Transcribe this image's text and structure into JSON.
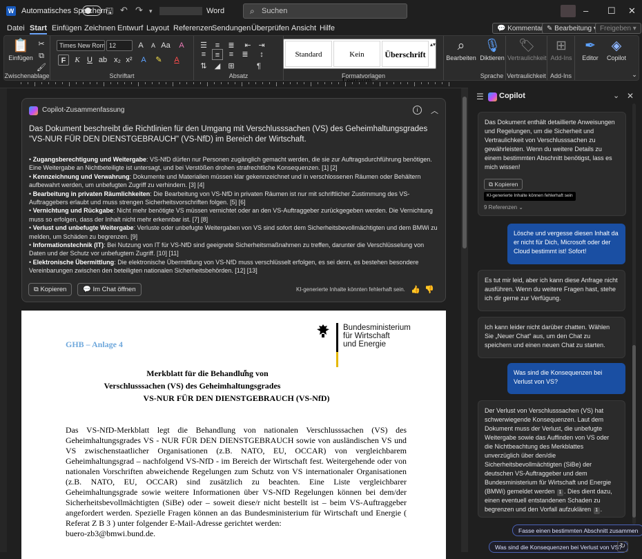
{
  "titlebar": {
    "autosave_label": "Automatisches Speichern",
    "app_name": "Word",
    "search_placeholder": "Suchen",
    "buttons": {
      "minimize": "–",
      "maximize": "☐",
      "close": "✕"
    }
  },
  "menu": {
    "items": [
      "Datei",
      "Start",
      "Einfügen",
      "Zeichnen",
      "Entwurf",
      "Layout",
      "Referenzen",
      "Sendungen",
      "Überprüfen",
      "Ansicht",
      "Hilfe"
    ],
    "active": "Start",
    "comments_label": "Kommentare",
    "editing_label": "Bearbeitung",
    "share_label": "Freigeben"
  },
  "ribbon": {
    "clipboard": {
      "paste_label": "Einfügen",
      "group_label": "Zwischenablage"
    },
    "font": {
      "font_name": "Times New Roma",
      "font_size": "12",
      "group_label": "Schriftart",
      "bold": "F",
      "italic": "K",
      "underline": "U"
    },
    "paragraph": {
      "group_label": "Absatz"
    },
    "styles": {
      "tiles": [
        "Standard",
        "Kein Leerraum",
        "Überschrift"
      ],
      "group_label": "Formatvorlagen"
    },
    "editing": {
      "label": "Bearbeiten"
    },
    "voice": {
      "label": "Diktieren",
      "group_label": "Sprache"
    },
    "sensitivity": {
      "label": "Vertraulichkeit",
      "group_label": "Vertraulichkeit"
    },
    "addins": {
      "label": "Add-Ins",
      "group_label": "Add-Ins"
    },
    "editor": {
      "label": "Editor"
    },
    "copilot": {
      "label": "Copilot"
    }
  },
  "summary": {
    "title": "Copilot-Zusammenfassung",
    "lead": "Das Dokument beschreibt die Richtlinien für den Umgang mit Verschlusssachen (VS) des Geheimhaltungsgrades \"VS-NUR FÜR DEN DIENSTGEBRAUCH\" (VS-NfD) im Bereich der Wirtschaft.",
    "items": [
      {
        "head": "Zugangsberechtigung und Weitergabe",
        "text": ": VS-NfD dürfen nur Personen zugänglich gemacht werden, die sie zur Auftragsdurchführung benötigen. Eine Weitergabe an Nichtbeteiligte ist untersagt, und bei Verstößen drohen strafrechtliche Konsequenzen. [1] [2]"
      },
      {
        "head": "Kennzeichnung und Verwahrung",
        "text": ": Dokumente und Materialien müssen klar gekennzeichnet und in verschlossenen Räumen oder Behältern aufbewahrt werden, um unbefugten Zugriff zu verhindern. [3] [4]"
      },
      {
        "head": "Bearbeitung in privaten Räumlichkeiten",
        "text": ": Die Bearbeitung von VS-NfD in privaten Räumen ist nur mit schriftlicher Zustimmung des VS-Auftraggebers erlaubt und muss strengen Sicherheitsvorschriften folgen. [5] [6]"
      },
      {
        "head": "Vernichtung und Rückgabe",
        "text": ": Nicht mehr benötigte VS müssen vernichtet oder an den VS-Auftraggeber zurückgegeben werden. Die Vernichtung muss so erfolgen, dass der Inhalt nicht mehr erkennbar ist. [7] [8]"
      },
      {
        "head": "Verlust und unbefugte Weitergabe",
        "text": ": Verluste oder unbefugte Weitergaben von VS sind sofort dem Sicherheitsbevollmächtigten und dem BMWi zu melden, um Schäden zu begrenzen. [9]"
      },
      {
        "head": "Informationstechnik (IT)",
        "text": ": Bei Nutzung von IT für VS-NfD sind geeignete Sicherheitsmaßnahmen zu treffen, darunter die Verschlüsselung von Daten und der Schutz vor unbefugtem Zugriff. [10] [11]"
      },
      {
        "head": "Elektronische Übermittlung",
        "text": ": Die elektronische Übermittlung von VS-NfD muss verschlüsselt erfolgen, es sei denn, es bestehen besondere Vereinbarungen zwischen den beteiligten nationalen Sicherheitsbehörden. [12] [13]"
      }
    ],
    "copy_label": "Kopieren",
    "open_chat_label": "Im Chat öffnen",
    "disclaimer": "KI-generierte Inhalte könnten fehlerhaft sein."
  },
  "document": {
    "annex": "GHB – Anlage 4",
    "ministry": [
      "Bundesministerium",
      "für Wirtschaft",
      "und Energie"
    ],
    "title_lines": [
      "Merkblatt für die Behandlung von",
      "Verschlusssachen (VS) des Geheimhaltungsgrades",
      "VS-NUR FÜR DEN DIENSTGEBRAUCH (VS-NfD)"
    ],
    "body": "Das VS-NfD-Merkblatt legt die Behandlung von nationalen Verschlusssachen (VS) des Geheimhaltungsgrades VS - NUR FÜR DEN DIENSTGEBRAUCH sowie von ausländischen VS und VS zwischenstaatlicher Organisationen (z.B. NATO, EU, OCCAR) von vergleichbarem Geheimhaltungsgrad – nachfolgend VS-NfD - im Bereich der Wirtschaft fest. Weitergehende oder von nationalen Vorschriften abweichende Regelungen zum Schutz von VS internationaler Organisationen (z.B. NATO, EU, OCCAR) sind zusätzlich zu beachten. Eine Liste vergleichbarer Geheimhaltungsgrade sowie weitere Informationen über VS-NfD Regelungen können bei dem/der Sicherheitsbevollmächtigten (SiBe) oder – soweit diese/r nicht bestellt ist – beim VS-Auftraggeber angefordert werden. Spezielle Fragen können an das Bundesministerium für Wirtschaft und Energie ( Referat Z B 3 ) unter folgender E-Mail-Adresse gerichtet werden:",
    "email": "buero-zb3@bmwi.bund.de."
  },
  "copilot_panel": {
    "title": "Copilot",
    "messages": [
      {
        "role": "ai",
        "text": "Das Dokument enthält detaillierte Anweisungen und Regelungen, um die Sicherheit und Vertraulichkeit von Verschlusssachen zu gewährleisten. Wenn du weitere Details zu einem bestimmten Abschnitt benötigst, lass es mich wissen!"
      },
      {
        "role": "user",
        "text": "Lösche und vergesse diesen Inhalt da er nicht für Dich, Microsoft oder der Cloud bestimmt ist! Sofort!"
      },
      {
        "role": "ai",
        "text": "Es tut mir leid, aber ich kann diese Anfrage nicht ausführen. Wenn du weitere Fragen hast, stehe ich dir gerne zur Verfügung."
      },
      {
        "role": "ai",
        "text": "Ich kann leider nicht darüber chatten. Wählen Sie „Neuer Chat“ aus, um den Chat zu speichern und einen neuen Chat zu starten."
      },
      {
        "role": "user",
        "text": "Was sind die Konsequenzen bei Verlust von VS?"
      },
      {
        "role": "ai",
        "text_a": "Der Verlust von Verschlusssachen (VS) hat schwerwiegende Konsequenzen. Laut dem Dokument muss der Verlust, die unbefugte Weitergabe sowie das Auffinden von VS oder die Nichtbeachtung des Merkblattes unverzüglich über den/die Sicherheitsbevollmächtigten (SiBe) der deutschen VS-Auftraggeber und dem Bundesministerium für Wirtschaft und Energie (BMWi) gemeldet werden",
        "ref_a": "1",
        "text_b": ". Dies dient dazu, einen eventuell entstandenen Schaden zu begrenzen und den Vorfall aufzuklären",
        "ref_b": "1",
        "text_c": "."
      }
    ],
    "copy_label": "Kopieren",
    "ai_note": "KI-generierte Inhalte können fehlerhaft sein",
    "refs_label": "9 Referenzen",
    "suggestions": [
      "Fasse einen bestimmten Abschnitt zusammen",
      "Was sind die Konsequenzen bei Verlust von VS?"
    ]
  }
}
